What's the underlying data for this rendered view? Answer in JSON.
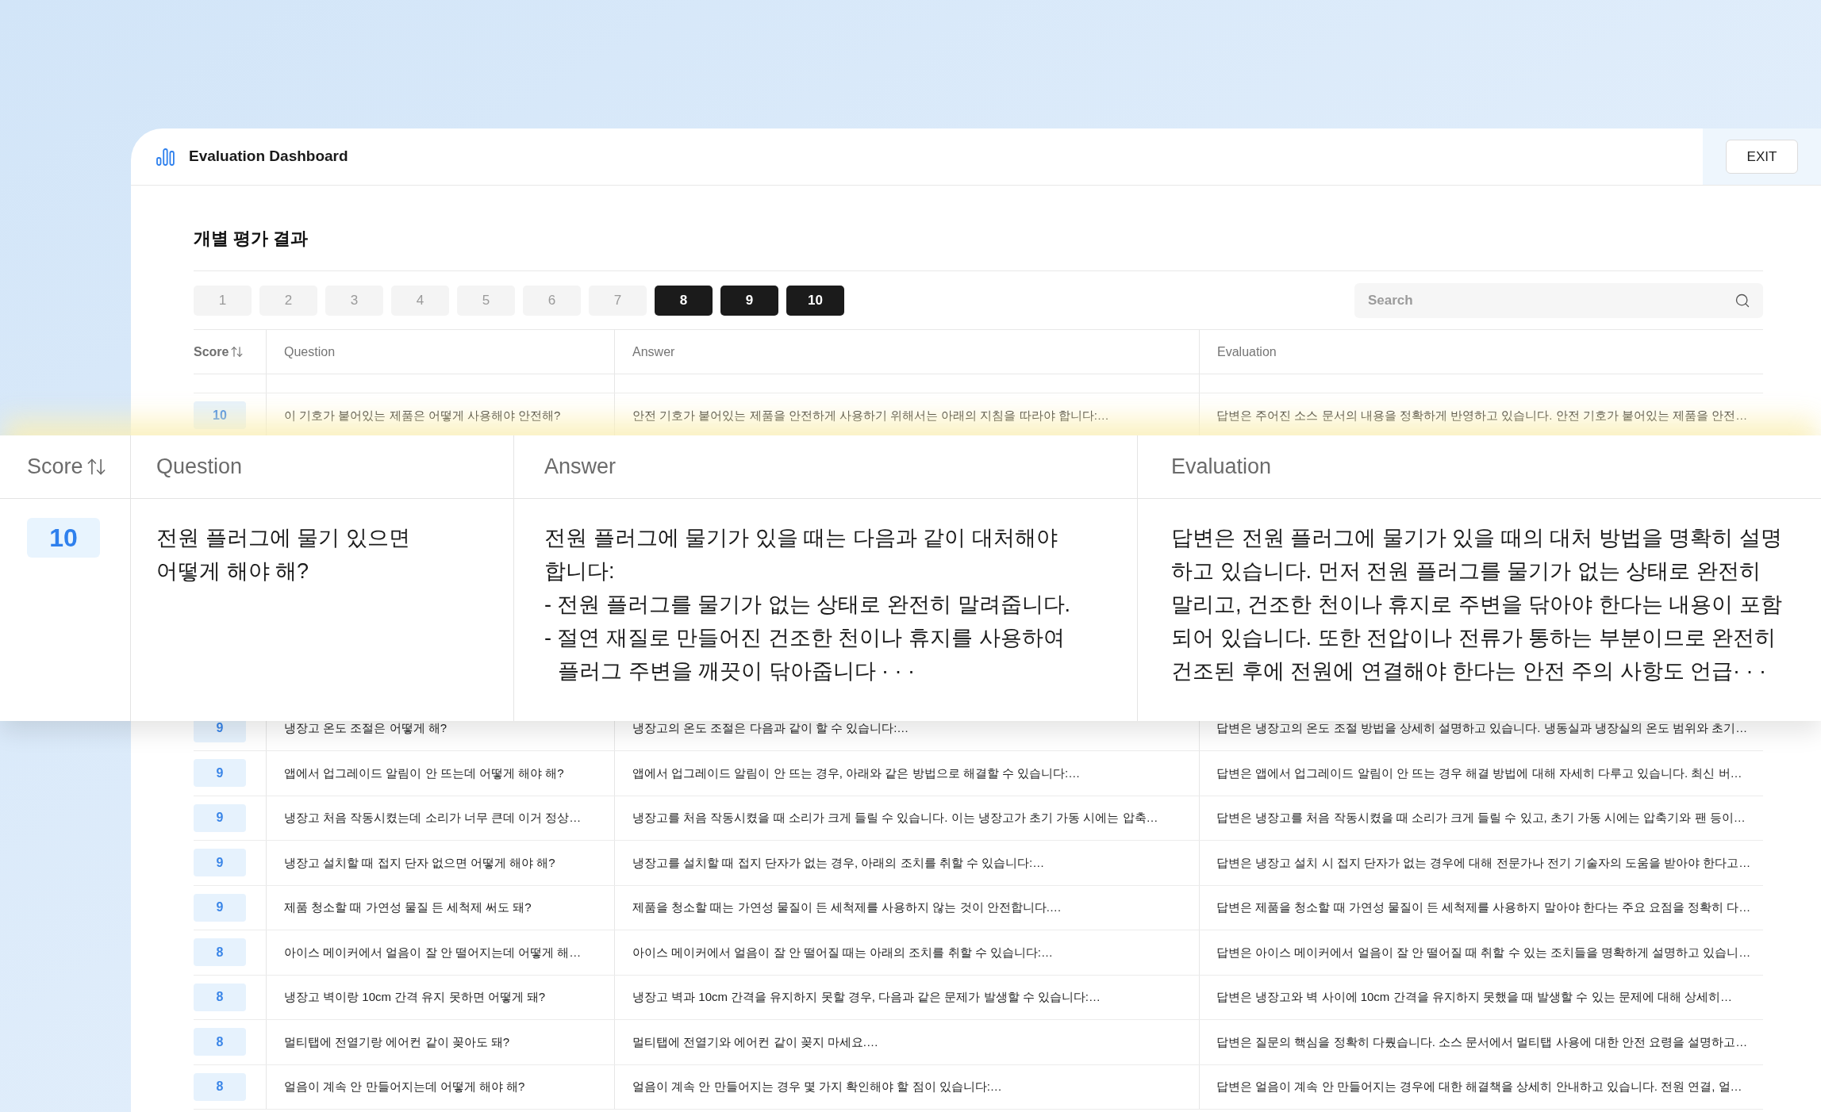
{
  "header": {
    "title": "Evaluation Dashboard",
    "exit_button": "EXIT"
  },
  "section_title": "개별 평가 결과",
  "score_filters": [
    {
      "label": "1",
      "selected": false
    },
    {
      "label": "2",
      "selected": false
    },
    {
      "label": "3",
      "selected": false
    },
    {
      "label": "4",
      "selected": false
    },
    {
      "label": "5",
      "selected": false
    },
    {
      "label": "6",
      "selected": false
    },
    {
      "label": "7",
      "selected": false
    },
    {
      "label": "8",
      "selected": true
    },
    {
      "label": "9",
      "selected": true
    },
    {
      "label": "10",
      "selected": true
    }
  ],
  "search": {
    "placeholder": "Search"
  },
  "table": {
    "columns": [
      {
        "label": "Score",
        "kind": "sortable"
      },
      {
        "label": "Question",
        "kind": "plain"
      },
      {
        "label": "Answer",
        "kind": "plain"
      },
      {
        "label": "Evaluation",
        "kind": "plain"
      }
    ],
    "rows": [
      {
        "score": "10",
        "question": "이 기호가 붙어있는 제품은 어떻게 사용해야 안전해?",
        "answer": "안전 기호가 붙어있는 제품을 안전하게 사용하기 위해서는 아래의 지침을 따라야 합니다:…",
        "evaluation": "답변은 주어진 소스 문서의 내용을 정확하게 반영하고 있습니다. 안전 기호가 붙어있는 제품을 안전…"
      },
      {
        "score": "9",
        "question": "냉장고 온도 조절은 어떻게 해?",
        "answer": "냉장고의 온도 조절은 다음과 같이 할 수 있습니다:…",
        "evaluation": "답변은 냉장고의 온도 조절 방법을 상세히 설명하고 있습니다. 냉동실과 냉장실의 온도 범위와 초기…"
      },
      {
        "score": "9",
        "question": "앱에서 업그레이드 알림이 안 뜨는데 어떻게 해야 해?",
        "answer": "앱에서 업그레이드 알림이 안 뜨는 경우, 아래와 같은 방법으로 해결할 수 있습니다:…",
        "evaluation": "답변은 앱에서 업그레이드 알림이 안 뜨는 경우 해결 방법에 대해 자세히 다루고 있습니다. 최신 버…"
      },
      {
        "score": "9",
        "question": "냉장고 처음 작동시켰는데 소리가 너무 큰데 이거 정상…",
        "answer": "냉장고를 처음 작동시켰을 때 소리가 크게 들릴 수 있습니다. 이는 냉장고가 초기 가동 시에는 압축…",
        "evaluation": "답변은 냉장고를 처음 작동시켰을 때 소리가 크게 들릴 수 있고, 초기 가동 시에는 압축기와 팬 등이…"
      },
      {
        "score": "9",
        "question": "냉장고 설치할 때 접지 단자 없으면 어떻게 해야 해?",
        "answer": "냉장고를 설치할 때 접지 단자가 없는 경우, 아래의 조치를 취할 수 있습니다:…",
        "evaluation": "답변은 냉장고 설치 시 접지 단자가 없는 경우에 대해 전문가나 전기 기술자의 도움을 받아야 한다고…"
      },
      {
        "score": "9",
        "question": "제품 청소할 때 가연성 물질 든 세척제 써도 돼?",
        "answer": "제품을 청소할 때는 가연성 물질이 든 세척제를 사용하지 않는 것이 안전합니다.…",
        "evaluation": "답변은 제품을 청소할 때 가연성 물질이 든 세척제를 사용하지 말아야 한다는 주요 요점을 정확히 다…"
      },
      {
        "score": "8",
        "question": "아이스 메이커에서 얼음이 잘 안 떨어지는데 어떻게 해…",
        "answer": "아이스 메이커에서 얼음이 잘 안 떨어질 때는 아래의 조치를 취할 수 있습니다:…",
        "evaluation": "답변은 아이스 메이커에서 얼음이 잘 안 떨어질 때 취할 수 있는 조치들을 명확하게 설명하고 있습니…"
      },
      {
        "score": "8",
        "question": "냉장고 벽이랑 10cm 간격 유지 못하면 어떻게 돼?",
        "answer": "냉장고 벽과 10cm 간격을 유지하지 못할 경우, 다음과 같은 문제가 발생할 수 있습니다:…",
        "evaluation": "답변은 냉장고와 벽 사이에 10cm 간격을 유지하지 못했을 때 발생할 수 있는 문제에 대해 상세히…"
      },
      {
        "score": "8",
        "question": "멀티탭에 전열기랑 에어컨 같이 꽂아도 돼?",
        "answer": "멀티탭에 전열기와 에어컨 같이 꽂지 마세요.…",
        "evaluation": "답변은 질문의 핵심을 정확히 다뤘습니다. 소스 문서에서 멀티탭 사용에 대한 안전 요령을 설명하고…"
      },
      {
        "score": "8",
        "question": "얼음이 계속 안 만들어지는데 어떻게 해야 해?",
        "answer": "얼음이 계속 안 만들어지는 경우 몇 가지 확인해야 할 점이 있습니다:…",
        "evaluation": "답변은 얼음이 계속 안 만들어지는 경우에 대한 해결책을 상세히 안내하고 있습니다. 전원 연결, 얼…"
      }
    ]
  },
  "magnified_row": {
    "columns": [
      {
        "label": "Score",
        "kind": "sortable"
      },
      {
        "label": "Question",
        "kind": "plain"
      },
      {
        "label": "Answer",
        "kind": "plain"
      },
      {
        "label": "Evaluation",
        "kind": "plain"
      }
    ],
    "score": "10",
    "question": "전원 플러그에 물기 있으면\n어떻게 해야 해?",
    "answer": {
      "intro": "전원 플러그에 물기가 있을 때는 다음과 같이 대처해야 합니다:",
      "items": [
        "- 전원 플러그를 물기가 없는 상태로 완전히 말려줍니다.",
        "- 절연 재질로 만들어진 건조한 천이나 휴지를 사용하여 플러그 주변을 깨끗이 닦아줍니다 · · ·"
      ]
    },
    "evaluation": "답변은 전원 플러그에 물기가 있을 때의 대처 방법을 명확히 설명하고 있습니다. 먼저 전원 플러그를 물기가 없는 상태로 완전히 말리고, 건조한 천이나 휴지로 주변을 닦아야 한다는 내용이 포함되어 있습니다. 또한 전압이나 전류가 통하는 부분이므로 완전히 건조된 후에 전원에 연결해야 한다는 안전 주의 사항도 언급· · ·"
  }
}
